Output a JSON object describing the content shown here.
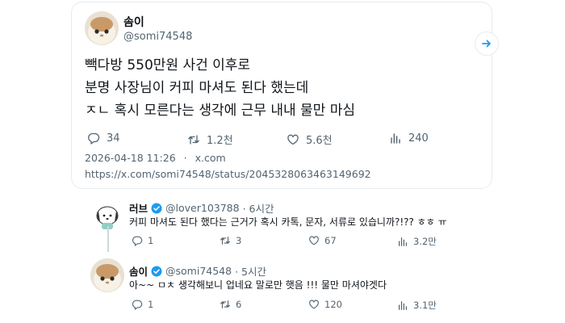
{
  "main_tweet": {
    "display_name": "솜이",
    "handle": "@somi74548",
    "lines": [
      "빽다방 550만원 사건 이후로",
      "분명 사장님이 커피 마셔도 된다 했는데",
      "ㅈㄴ 혹시 모른다는 생각에 근무 내내 물만 마심"
    ],
    "stats": {
      "replies": "34",
      "retweets": "1.2천",
      "likes": "5.6천",
      "views": "240"
    },
    "datetime": "2026-04-18 11:26",
    "source_sep": "·",
    "source": "x.com",
    "url": "https://x.com/somi74548/status/2045328063463149692"
  },
  "replies": [
    {
      "display_name": "러브",
      "handle": "@lover103788",
      "time": "· 6시간",
      "text": "커피 마셔도 된다 했다는 근거가 혹시 카톡, 문자, 서류로 있습니까?!?? ㅎㅎ ㅠ",
      "stats": {
        "replies": "1",
        "retweets": "3",
        "likes": "67",
        "views": "3.2만"
      }
    },
    {
      "display_name": "솜이",
      "handle": "@somi74548",
      "time": "· 5시간",
      "text": "아~~ ㅁㅊ 생각해보니 업네요 말로만 햇음 !!! 물만 마셔야겟다",
      "stats": {
        "replies": "1",
        "retweets": "6",
        "likes": "120",
        "views": "3.1만"
      }
    }
  ],
  "colors": {
    "text": "#0f1419",
    "muted": "#536471",
    "verified": "#1d9bf0",
    "border": "#e6ecf0"
  },
  "icons": [
    "reply-icon",
    "retweet-icon",
    "like-icon",
    "views-icon",
    "verified-icon",
    "arrow-right-icon"
  ]
}
